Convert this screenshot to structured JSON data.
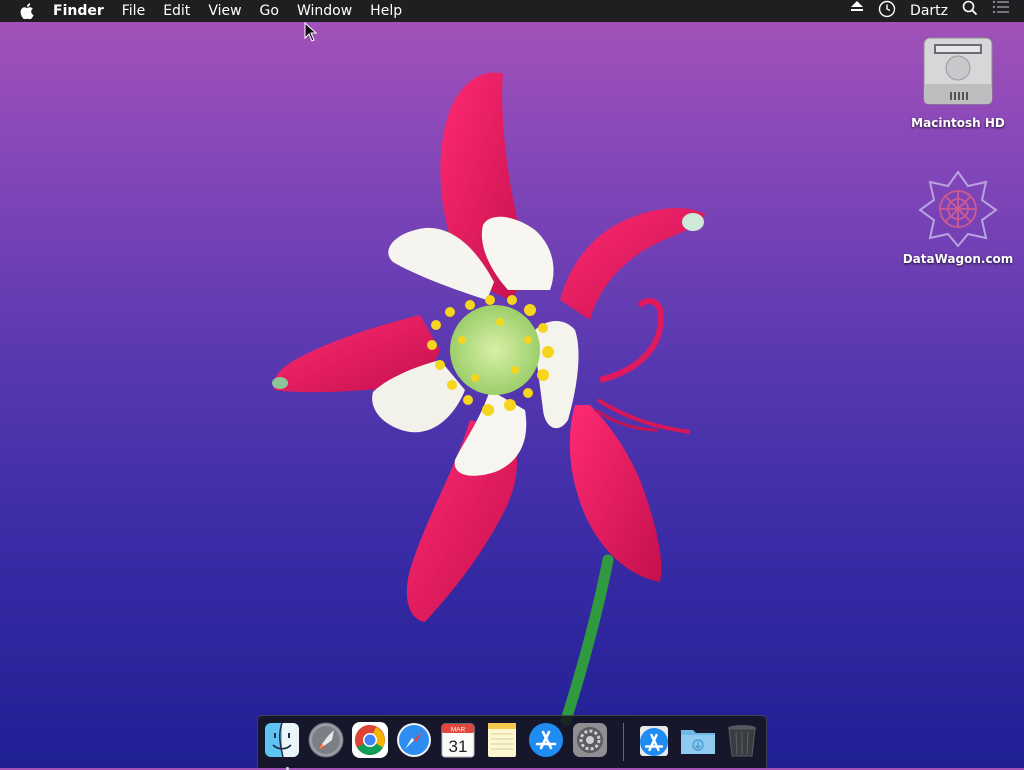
{
  "menubar": {
    "apple_icon": "apple-logo-icon",
    "app_name": "Finder",
    "menus": [
      "File",
      "Edit",
      "View",
      "Go",
      "Window",
      "Help"
    ],
    "status": {
      "eject_icon": "eject-icon",
      "clock_icon": "clock-icon",
      "user_name": "Dartz",
      "search_icon": "spotlight-search-icon",
      "notifications_icon": "notification-center-icon"
    }
  },
  "desktop": {
    "icons": [
      {
        "label": "Macintosh HD",
        "icon": "hard-drive-icon"
      },
      {
        "label": "DataWagon.com",
        "icon": "network-volume-icon"
      }
    ]
  },
  "dock": {
    "apps": [
      {
        "name": "Finder",
        "icon": "finder-icon",
        "running": true
      },
      {
        "name": "Launchpad",
        "icon": "launchpad-icon",
        "running": false
      },
      {
        "name": "Google Chrome",
        "icon": "chrome-icon",
        "running": false
      },
      {
        "name": "Safari",
        "icon": "safari-icon",
        "running": false
      },
      {
        "name": "Calendar",
        "icon": "calendar-icon",
        "running": false,
        "month": "MAR",
        "day": "31"
      },
      {
        "name": "Notes",
        "icon": "notes-icon",
        "running": false
      },
      {
        "name": "App Store",
        "icon": "app-store-icon",
        "running": false
      },
      {
        "name": "System Preferences",
        "icon": "system-preferences-icon",
        "running": false
      }
    ],
    "stacks": [
      {
        "name": "Install App",
        "icon": "app-store-installer-icon"
      },
      {
        "name": "Downloads",
        "icon": "downloads-folder-icon"
      },
      {
        "name": "Trash",
        "icon": "trash-icon"
      }
    ]
  },
  "colors": {
    "menubar_bg": "#1f1f22",
    "wallpaper_top": "#a653b9",
    "wallpaper_bottom": "#1f1f94",
    "petal_red": "#e0195f",
    "petal_white": "#f5f4ee",
    "stamen_yellow": "#f5d51e"
  }
}
